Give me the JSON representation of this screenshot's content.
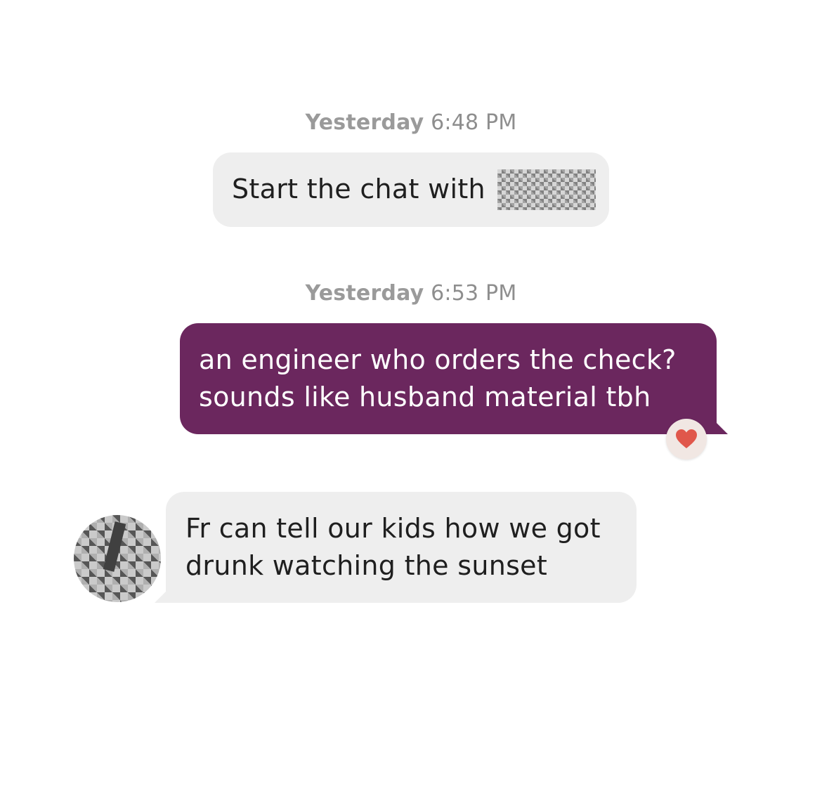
{
  "conversation": {
    "messages": [
      {
        "kind": "system",
        "day": "Yesterday",
        "time": "6:48 PM",
        "text": "Start the chat with"
      },
      {
        "kind": "sent",
        "day": "Yesterday",
        "time": "6:53 PM",
        "lines": [
          "an engineer who orders the check?",
          "sounds like husband material tbh"
        ],
        "reaction": "heart-icon"
      },
      {
        "kind": "received",
        "lines": [
          "Fr can tell our kids how we got",
          "drunk watching the sunset"
        ]
      }
    ]
  },
  "colors": {
    "sent_bubble": "#6b275e",
    "received_bubble": "#eeeeee",
    "timestamp": "#8e8e8e",
    "heart": "#e0574b"
  }
}
